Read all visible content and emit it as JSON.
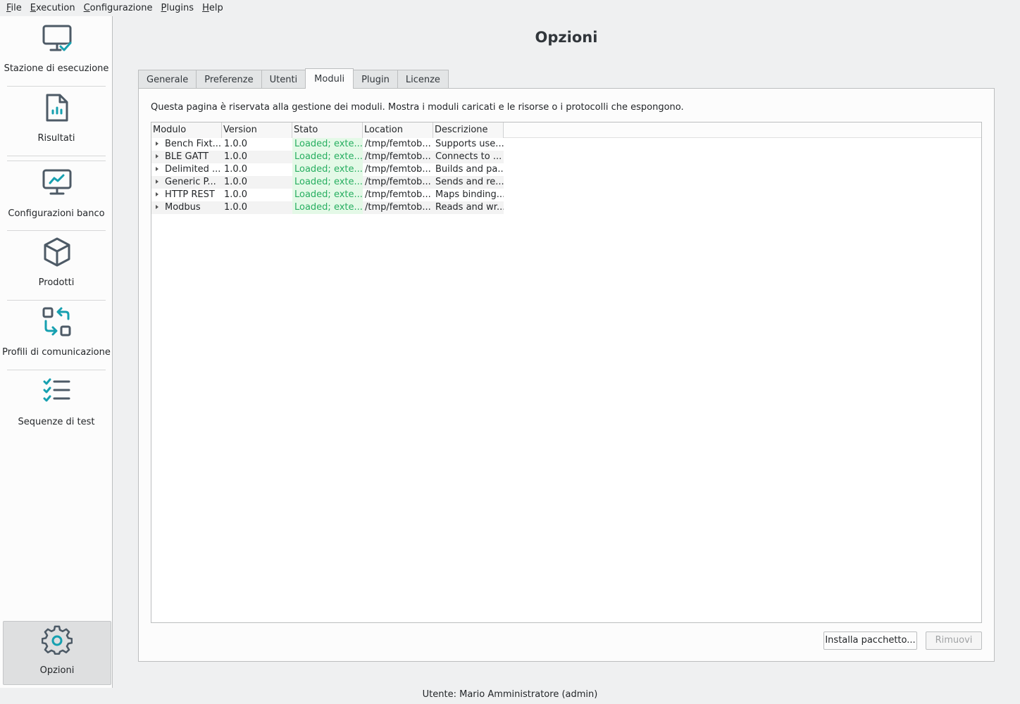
{
  "menu": [
    {
      "label_pre": "",
      "label_ul": "F",
      "label_post": "ile"
    },
    {
      "label_pre": "",
      "label_ul": "E",
      "label_post": "xecution"
    },
    {
      "label_pre": "",
      "label_ul": "C",
      "label_post": "onfigurazione"
    },
    {
      "label_pre": "",
      "label_ul": "P",
      "label_post": "lugins"
    },
    {
      "label_pre": "",
      "label_ul": "H",
      "label_post": "elp"
    }
  ],
  "sidebar": {
    "items": [
      {
        "label": "Stazione di esecuzione",
        "icon": "monitor-check-icon"
      },
      {
        "label": "Risultati",
        "icon": "report-file-icon"
      },
      {
        "label": "Configurazioni banco",
        "icon": "monitor-chart-icon"
      },
      {
        "label": "Prodotti",
        "icon": "cube-icon"
      },
      {
        "label": "Profili di comunicazione",
        "icon": "swap-icon"
      },
      {
        "label": "Sequenze di test",
        "icon": "checklist-icon"
      }
    ],
    "bottom": {
      "label": "Opzioni",
      "icon": "gear-icon"
    }
  },
  "main": {
    "title": "Opzioni",
    "tabs": [
      "Generale",
      "Preferenze",
      "Utenti",
      "Moduli",
      "Plugin",
      "Licenze"
    ],
    "active_tab": "Moduli",
    "description": "Questa pagina è riservata alla gestione dei moduli. Mostra i moduli caricati e le risorse o i protocolli che espongono.",
    "table": {
      "columns": [
        "Modulo",
        "Version",
        "Stato",
        "Location",
        "Descrizione"
      ],
      "rows": [
        [
          "Bench Fixt...",
          "1.0.0",
          "Loaded; exte...",
          "/tmp/femtob...",
          "Supports use..."
        ],
        [
          "BLE GATT",
          "1.0.0",
          "Loaded; exte...",
          "/tmp/femtob...",
          "Connects to ..."
        ],
        [
          "Delimited ...",
          "1.0.0",
          "Loaded; exte...",
          "/tmp/femtob...",
          "Builds and pa..."
        ],
        [
          "Generic P...",
          "1.0.0",
          "Loaded; exte...",
          "/tmp/femtob...",
          "Sends and re..."
        ],
        [
          "HTTP REST",
          "1.0.0",
          "Loaded; exte...",
          "/tmp/femtob...",
          "Maps binding..."
        ],
        [
          "Modbus",
          "1.0.0",
          "Loaded; exte...",
          "/tmp/femtob...",
          "Reads and wr..."
        ]
      ]
    },
    "install_button": "Installa pacchetto...",
    "remove_button": "Rimuovi"
  },
  "status": "Utente: Mario Amministratore (admin)",
  "colors": {
    "accent": "#1d99f3",
    "icon_teal": "#16a0b0",
    "icon_gray": "#4d5a66",
    "status_green": "#27ae60"
  }
}
